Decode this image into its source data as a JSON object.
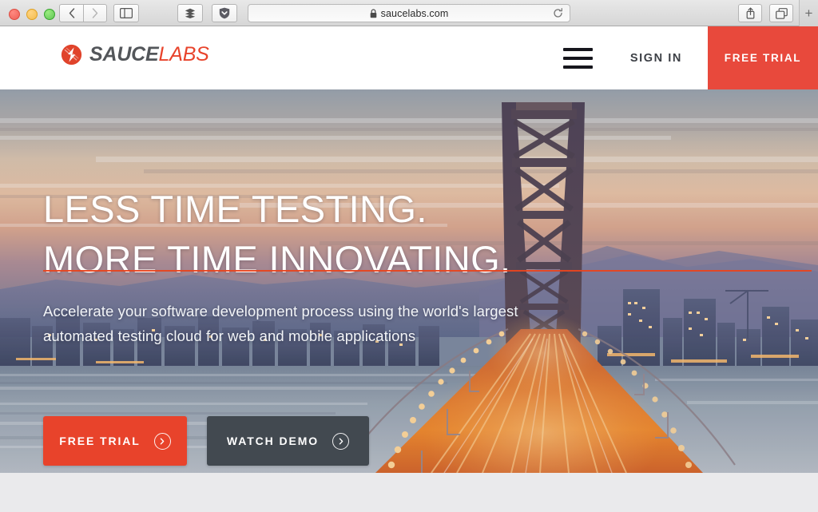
{
  "browser": {
    "url": "saucelabs.com",
    "lock_icon": "lock-icon",
    "reload_icon": "reload-icon",
    "back_icon": "chevron-left-icon",
    "forward_icon": "chevron-right-icon",
    "sidebar_icon": "sidebar-toggle-icon",
    "topsites_icon": "top-sites-icon",
    "shield_icon": "shield-icon",
    "share_icon": "share-icon",
    "tabs_icon": "show-all-tabs-icon",
    "newtab_label": "+",
    "traffic_lights": [
      "close-button",
      "minimize-button",
      "zoom-button"
    ]
  },
  "site": {
    "logo": {
      "mark": "sauce-labs-bolt-icon",
      "word_primary": "SAUCE",
      "word_secondary": "LABS"
    },
    "nav": {
      "menu_icon": "hamburger-menu-icon",
      "sign_in": "SIGN IN",
      "free_trial": "FREE TRIAL"
    },
    "hero": {
      "headline_line1": "LESS TIME TESTING.",
      "headline_line2": "MORE TIME INNOVATING.",
      "subhead_line1": "Accelerate your software development process using the world's",
      "subhead_line2": "largest automated testing cloud for web and mobile applications",
      "cta_primary": "FREE TRIAL",
      "cta_secondary": "WATCH DEMO",
      "cta_icon": "arrow-right-circle-icon",
      "background": "bay-bridge-sunset-photo"
    }
  },
  "colors": {
    "brand_red": "#e8432b",
    "nav_red": "#e8493c",
    "dark_slate": "#424950",
    "logo_gray": "#53565a",
    "page_gray": "#eaeaec"
  }
}
